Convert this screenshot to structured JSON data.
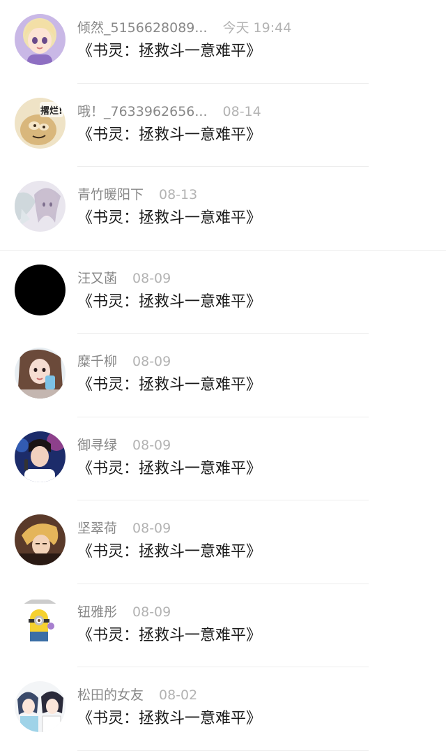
{
  "comments": [
    {
      "user": "倾然_5156628089...",
      "time": "今天 19:44",
      "text": "《书灵：拯救斗一意难平》",
      "avatar": "cartoon-girl-avatar"
    },
    {
      "user": "哦！_7633962656...",
      "time": "08-14",
      "text": "《书灵：拯救斗一意难平》",
      "avatar": "meme-sticker-avatar",
      "avatar_text": "撂烂!"
    },
    {
      "user": "青竹暖阳下",
      "time": "08-13",
      "text": "《书灵：拯救斗一意难平》",
      "avatar": "anime-illustration-avatar"
    },
    {
      "user": "汪又菡",
      "time": "08-09",
      "text": "《书灵：拯救斗一意难平》",
      "avatar": "black-avatar"
    },
    {
      "user": "糜千柳",
      "time": "08-09",
      "text": "《书灵：拯救斗一意难平》",
      "avatar": "selfie-girl-avatar"
    },
    {
      "user": "御寻绿",
      "time": "08-09",
      "text": "《书灵：拯救斗一意难平》",
      "avatar": "singer-photo-avatar"
    },
    {
      "user": "坚翠荷",
      "time": "08-09",
      "text": "《书灵：拯救斗一意难平》",
      "avatar": "blonde-boy-avatar"
    },
    {
      "user": "钮雅彤",
      "time": "08-09",
      "text": "《书灵：拯救斗一意难平》",
      "avatar": "minion-avatar"
    },
    {
      "user": "松田的女友",
      "time": "08-02",
      "text": "《书灵：拯救斗一意难平》",
      "avatar": "anime-couple-avatar"
    }
  ],
  "colors": {
    "username": "#888888",
    "timestamp": "#b3b3b3",
    "comment_text": "#1a1a1a",
    "divider": "#ededed"
  }
}
